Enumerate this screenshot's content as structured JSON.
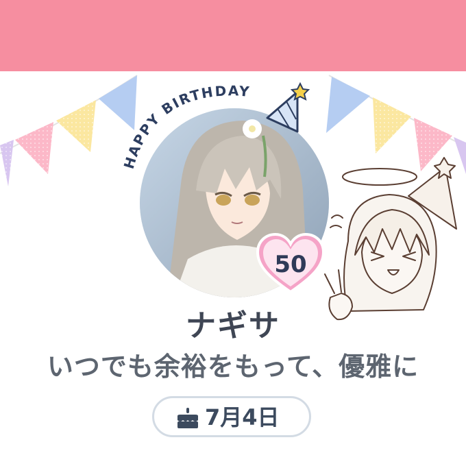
{
  "banner": {
    "color": "#f68ea0"
  },
  "greeting": {
    "text": "HAPPY BIRTHDAY",
    "color": "#2d3e60"
  },
  "avatar": {
    "icon": "character-portrait"
  },
  "affection": {
    "value": "50",
    "heart_color": "#f5a3c7",
    "text_color": "#2f3a58"
  },
  "character": {
    "name": "ナギサ",
    "motto": "いつでも余裕をもって、優雅に"
  },
  "birthday": {
    "icon": "cake-icon",
    "date": "7月4日",
    "border_color": "#d3dbe4"
  },
  "colors": {
    "text_primary": "#3f4654",
    "text_secondary": "#5d6570",
    "pennant_blue": "#b5cdf2",
    "pennant_yellow": "#fbe7a0",
    "pennant_pink": "#fcb8c8",
    "pennant_purple": "#d8c6f0"
  }
}
